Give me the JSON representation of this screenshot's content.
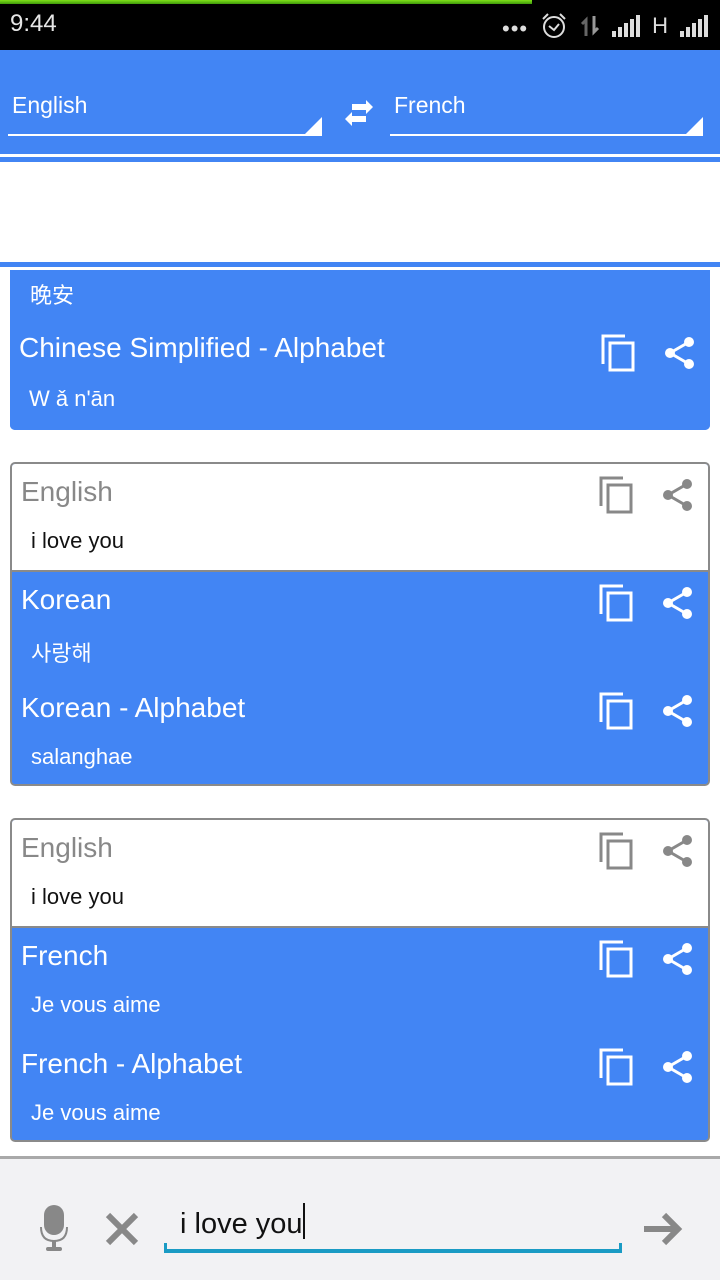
{
  "status_bar": {
    "time": "9:44",
    "icons": [
      "more-dots-icon",
      "alarm-icon",
      "data-transfer-icon",
      "signal-icon",
      "network-type-h",
      "signal-icon"
    ],
    "network_type": "H",
    "dots": "•••"
  },
  "header": {
    "from_language": "English",
    "to_language": "French",
    "swap_icon": "swap-arrows-icon"
  },
  "colors": {
    "primary": "#4285f4",
    "source_title": "#888888",
    "input_underline": "#1a9bc4",
    "bottom_bar_bg": "#f2f2f4"
  },
  "partial_card": {
    "top_text": "晚安",
    "sections": [
      {
        "title": "Chinese Simplified - Alphabet",
        "text": "W ǎ n'ān"
      }
    ]
  },
  "cards": [
    {
      "source": {
        "title": "English",
        "text": "i love you"
      },
      "targets": [
        {
          "title": "Korean",
          "text": "사랑해"
        },
        {
          "title": "Korean - Alphabet",
          "text": "salanghae"
        }
      ]
    },
    {
      "source": {
        "title": "English",
        "text": "i love you"
      },
      "targets": [
        {
          "title": "French",
          "text": "Je vous aime"
        },
        {
          "title": "French - Alphabet",
          "text": "Je vous aime"
        }
      ]
    }
  ],
  "bottom_bar": {
    "input_value": "i love you",
    "mic_icon": "microphone-icon",
    "clear_icon": "clear-x-icon",
    "send_icon": "arrow-right-icon"
  }
}
